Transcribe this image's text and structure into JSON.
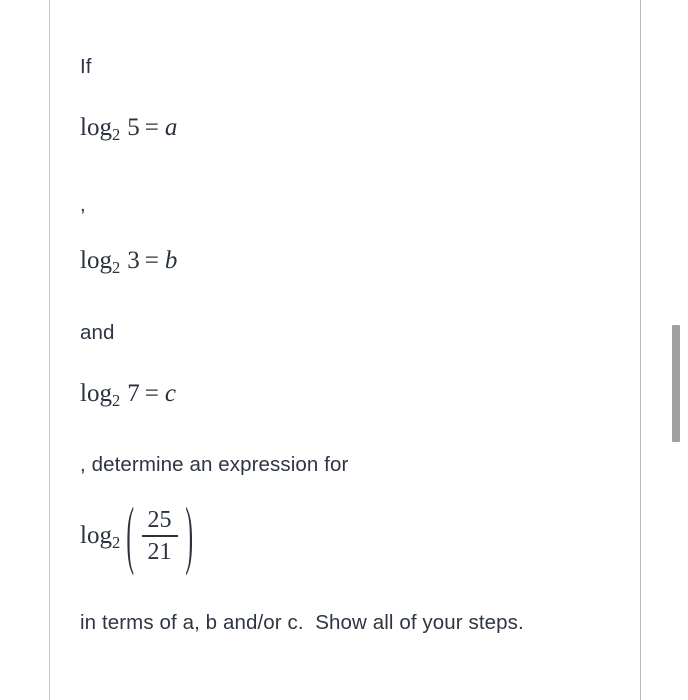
{
  "page": {
    "background_color": "#ffffff",
    "text_color": "#2d3642",
    "math_color": "#2a323d",
    "rule_color": "#c7c7c7"
  },
  "scrollbar": {
    "name": "vertical-scrollbar",
    "thumb_color": "#a0a0a0"
  },
  "problem": {
    "line_if": "If",
    "equation_a": {
      "fn": "log",
      "base": "2",
      "argument": "5",
      "relation": "=",
      "variable": "a"
    },
    "line_comma": ",",
    "equation_b": {
      "fn": "log",
      "base": "2",
      "argument": "3",
      "relation": "=",
      "variable": "b"
    },
    "line_and": "and",
    "equation_c": {
      "fn": "log",
      "base": "2",
      "argument": "7",
      "relation": "=",
      "variable": "c"
    },
    "line_determine": ", determine an expression for",
    "expression": {
      "fn": "log",
      "base": "2",
      "open_paren": "(",
      "numerator": "25",
      "denominator": "21",
      "close_paren": ")"
    },
    "line_tail": "in terms of a, b and/or c.  Show all of your steps."
  }
}
